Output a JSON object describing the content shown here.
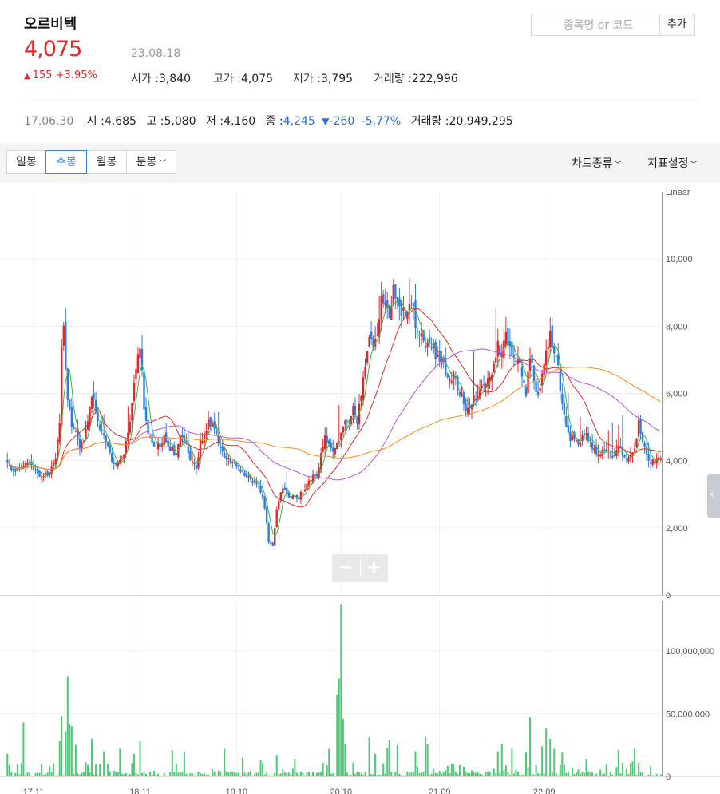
{
  "stock": {
    "name": "오르비텍",
    "price": "4,075",
    "change": "155 +3.95%",
    "date": "23.08.18",
    "open_label": "시가 :",
    "open": "3,840",
    "high_label": "고가 :",
    "high": "4,075",
    "low_label": "저가 :",
    "low": "3,795",
    "volume_label": "거래량 :",
    "volume": "222,996"
  },
  "search": {
    "placeholder": "종목명 or 코드",
    "add_label": "추가"
  },
  "history": {
    "date": "17.06.30",
    "open_label": "시 :",
    "open": "4,685",
    "high_label": "고 :",
    "high": "5,080",
    "low_label": "저 :",
    "low": "4,160",
    "close_label": "종 :",
    "close": "4,245",
    "change": "-260",
    "change_pct": "-5.77%",
    "volume_label": "거래량 :",
    "volume": "20,949,295"
  },
  "toolbar": {
    "tabs": [
      "일봉",
      "주봉",
      "월봉",
      "분봉"
    ],
    "active_tab": "주봉",
    "chart_type_label": "차트종류",
    "indicator_label": "지표설정"
  },
  "zoom": {
    "minus": "−",
    "plus": "+"
  },
  "colors": {
    "up": "#e0282b",
    "down": "#2f7ddb",
    "ma5": "#3cb44b",
    "ma20": "#d9302c",
    "ma60": "#b05cd6",
    "ma120": "#ef8f22",
    "volume": "#4fc877"
  },
  "chart_data": {
    "type": "candlestick",
    "scale_label": "Linear",
    "price_axis": {
      "ticks": [
        0,
        2000,
        4000,
        6000,
        8000,
        10000
      ],
      "tick_labels": [
        "0",
        "2,000",
        "4,000",
        "6,000",
        "8,000",
        "10,000"
      ],
      "ylim": [
        0,
        12000
      ]
    },
    "volume_axis": {
      "ticks": [
        0,
        50000000,
        100000000
      ],
      "tick_labels": [
        "0",
        "50,000,000",
        "100,000,000"
      ],
      "ylim": [
        0,
        140000000
      ]
    },
    "x_tick_labels": [
      "17.11",
      "18.11",
      "19.10",
      "20.10",
      "21.09",
      "22.09"
    ],
    "x_tick_index": [
      13,
      66,
      114,
      166,
      215,
      267
    ],
    "close_anchors": [
      [
        0,
        3900
      ],
      [
        3,
        3700
      ],
      [
        6,
        3800
      ],
      [
        9,
        4000
      ],
      [
        12,
        3900
      ],
      [
        15,
        3600
      ],
      [
        18,
        3550
      ],
      [
        21,
        3600
      ],
      [
        24,
        4000
      ],
      [
        26,
        5200
      ],
      [
        27,
        7300
      ],
      [
        28,
        8000
      ],
      [
        29,
        6800
      ],
      [
        30,
        5900
      ],
      [
        32,
        5100
      ],
      [
        34,
        4800
      ],
      [
        36,
        4400
      ],
      [
        38,
        4600
      ],
      [
        40,
        5300
      ],
      [
        42,
        6000
      ],
      [
        44,
        5500
      ],
      [
        46,
        5000
      ],
      [
        48,
        4700
      ],
      [
        50,
        4400
      ],
      [
        52,
        4000
      ],
      [
        55,
        3900
      ],
      [
        58,
        4200
      ],
      [
        60,
        4900
      ],
      [
        62,
        5600
      ],
      [
        64,
        6800
      ],
      [
        66,
        7400
      ],
      [
        67,
        6800
      ],
      [
        68,
        5500
      ],
      [
        70,
        4900
      ],
      [
        72,
        4500
      ],
      [
        74,
        4400
      ],
      [
        76,
        4500
      ],
      [
        78,
        4700
      ],
      [
        80,
        4500
      ],
      [
        82,
        4300
      ],
      [
        84,
        4200
      ],
      [
        86,
        4800
      ],
      [
        88,
        4600
      ],
      [
        90,
        4300
      ],
      [
        92,
        3900
      ],
      [
        94,
        3800
      ],
      [
        96,
        4500
      ],
      [
        98,
        4700
      ],
      [
        100,
        5100
      ],
      [
        102,
        5000
      ],
      [
        104,
        4800
      ],
      [
        106,
        4400
      ],
      [
        108,
        4100
      ],
      [
        110,
        4000
      ],
      [
        112,
        3900
      ],
      [
        114,
        3900
      ],
      [
        116,
        3700
      ],
      [
        118,
        3500
      ],
      [
        120,
        3600
      ],
      [
        122,
        3400
      ],
      [
        124,
        3300
      ],
      [
        126,
        3100
      ],
      [
        128,
        2600
      ],
      [
        130,
        1600
      ],
      [
        132,
        1500
      ],
      [
        134,
        2500
      ],
      [
        136,
        3000
      ],
      [
        138,
        3200
      ],
      [
        140,
        2900
      ],
      [
        142,
        3000
      ],
      [
        144,
        2800
      ],
      [
        146,
        3000
      ],
      [
        148,
        3100
      ],
      [
        150,
        3400
      ],
      [
        152,
        3600
      ],
      [
        154,
        3500
      ],
      [
        156,
        4200
      ],
      [
        158,
        4700
      ],
      [
        160,
        4400
      ],
      [
        162,
        4300
      ],
      [
        164,
        4500
      ],
      [
        166,
        4800
      ],
      [
        168,
        5200
      ],
      [
        170,
        5100
      ],
      [
        172,
        5500
      ],
      [
        174,
        5100
      ],
      [
        176,
        6000
      ],
      [
        178,
        6900
      ],
      [
        180,
        7700
      ],
      [
        182,
        7200
      ],
      [
        184,
        7900
      ],
      [
        186,
        8700
      ],
      [
        188,
        8900
      ],
      [
        190,
        8200
      ],
      [
        192,
        9200
      ],
      [
        194,
        8800
      ],
      [
        196,
        8500
      ],
      [
        198,
        8400
      ],
      [
        200,
        8800
      ],
      [
        202,
        8400
      ],
      [
        204,
        7800
      ],
      [
        206,
        7600
      ],
      [
        208,
        7200
      ],
      [
        210,
        7600
      ],
      [
        212,
        7300
      ],
      [
        214,
        7100
      ],
      [
        216,
        6900
      ],
      [
        218,
        6700
      ],
      [
        220,
        6300
      ],
      [
        222,
        6600
      ],
      [
        224,
        6100
      ],
      [
        226,
        6000
      ],
      [
        228,
        5600
      ],
      [
        230,
        5700
      ],
      [
        232,
        5800
      ],
      [
        234,
        5900
      ],
      [
        236,
        6200
      ],
      [
        238,
        6300
      ],
      [
        240,
        6400
      ],
      [
        242,
        6800
      ],
      [
        244,
        7400
      ],
      [
        246,
        7200
      ],
      [
        248,
        7700
      ],
      [
        250,
        7400
      ],
      [
        252,
        7000
      ],
      [
        254,
        7100
      ],
      [
        256,
        6600
      ],
      [
        258,
        6000
      ],
      [
        260,
        7100
      ],
      [
        262,
        6400
      ],
      [
        264,
        5900
      ],
      [
        266,
        6600
      ],
      [
        268,
        7200
      ],
      [
        270,
        7700
      ],
      [
        272,
        7300
      ],
      [
        274,
        6800
      ],
      [
        276,
        5600
      ],
      [
        278,
        5100
      ],
      [
        280,
        4700
      ],
      [
        282,
        4600
      ],
      [
        284,
        4500
      ],
      [
        286,
        4800
      ],
      [
        288,
        4900
      ],
      [
        290,
        4500
      ],
      [
        292,
        4300
      ],
      [
        294,
        4100
      ],
      [
        296,
        4400
      ],
      [
        298,
        4300
      ],
      [
        300,
        4200
      ],
      [
        302,
        4100
      ],
      [
        304,
        4400
      ],
      [
        306,
        4200
      ],
      [
        308,
        4000
      ],
      [
        310,
        4100
      ],
      [
        312,
        4300
      ],
      [
        314,
        5200
      ],
      [
        316,
        4500
      ],
      [
        318,
        4200
      ],
      [
        320,
        3900
      ],
      [
        322,
        4000
      ],
      [
        324,
        4075
      ]
    ],
    "volume_spikes": [
      [
        0,
        18000000
      ],
      [
        8,
        43000000
      ],
      [
        26,
        28000000
      ],
      [
        27,
        48000000
      ],
      [
        29,
        36000000
      ],
      [
        30,
        80000000
      ],
      [
        31,
        42000000
      ],
      [
        32,
        40000000
      ],
      [
        34,
        25000000
      ],
      [
        42,
        30000000
      ],
      [
        48,
        20000000
      ],
      [
        56,
        22000000
      ],
      [
        63,
        18000000
      ],
      [
        66,
        28000000
      ],
      [
        82,
        21000000
      ],
      [
        88,
        20000000
      ],
      [
        108,
        22000000
      ],
      [
        117,
        15000000
      ],
      [
        126,
        13000000
      ],
      [
        134,
        17000000
      ],
      [
        143,
        14000000
      ],
      [
        160,
        22000000
      ],
      [
        164,
        65000000
      ],
      [
        165,
        78000000
      ],
      [
        166,
        137000000
      ],
      [
        167,
        46000000
      ],
      [
        168,
        26000000
      ],
      [
        180,
        31000000
      ],
      [
        183,
        18000000
      ],
      [
        189,
        23000000
      ],
      [
        190,
        29000000
      ],
      [
        194,
        25000000
      ],
      [
        203,
        20000000
      ],
      [
        208,
        31000000
      ],
      [
        209,
        26000000
      ],
      [
        244,
        20000000
      ],
      [
        246,
        26000000
      ],
      [
        251,
        22000000
      ],
      [
        258,
        19000000
      ],
      [
        260,
        47000000
      ],
      [
        266,
        24000000
      ],
      [
        268,
        38000000
      ],
      [
        270,
        30000000
      ],
      [
        272,
        22000000
      ],
      [
        276,
        19000000
      ],
      [
        288,
        14000000
      ],
      [
        304,
        21000000
      ],
      [
        312,
        22000000
      ],
      [
        314,
        11000000
      ]
    ]
  }
}
